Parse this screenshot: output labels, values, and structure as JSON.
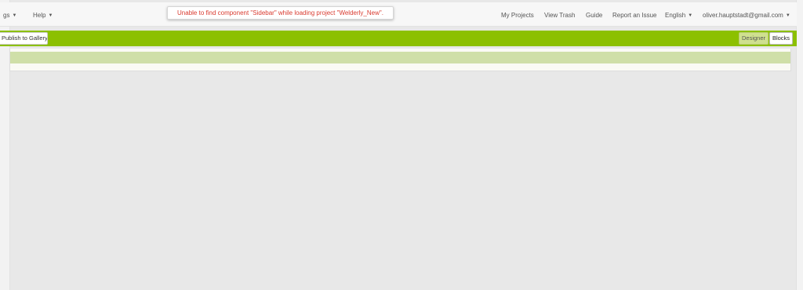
{
  "topbar": {
    "left_menu": [
      {
        "label": "gs"
      },
      {
        "label": "Help"
      }
    ],
    "right_menu": {
      "my_projects": "My Projects",
      "view_trash": "View Trash",
      "guide": "Guide",
      "report_issue": "Report an Issue",
      "language": "English",
      "account": "oliver.hauptstadt@gmail.com"
    },
    "error_message": "Unable to find component \"Sidebar\" while loading project \"Welderly_New\"."
  },
  "toolbar": {
    "publish_label": "Publish to Gallery",
    "designer_label": "Designer",
    "blocks_label": "Blocks"
  },
  "colors": {
    "toolbar_green": "#8cc000",
    "error_red": "#d93a2f",
    "subbar_green": "#cfdfa8"
  }
}
